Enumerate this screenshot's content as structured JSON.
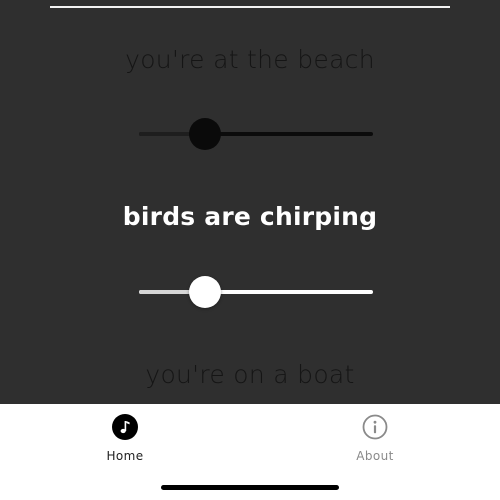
{
  "sounds": [
    {
      "label": "you're at the beach",
      "level": 0.28,
      "active": false
    },
    {
      "label": "birds are chirping",
      "level": 0.28,
      "active": true
    },
    {
      "label": "you're on a boat",
      "active": false
    }
  ],
  "tab_bar": {
    "tabs": [
      {
        "label": "Home",
        "icon": "music-note-icon",
        "selected": true
      },
      {
        "label": "About",
        "icon": "info-icon",
        "selected": false
      }
    ]
  },
  "colors": {
    "background": "#2f2f2f",
    "active_text": "#ffffff",
    "inactive_text": "#151515",
    "tab_bar": "#ffffff"
  }
}
